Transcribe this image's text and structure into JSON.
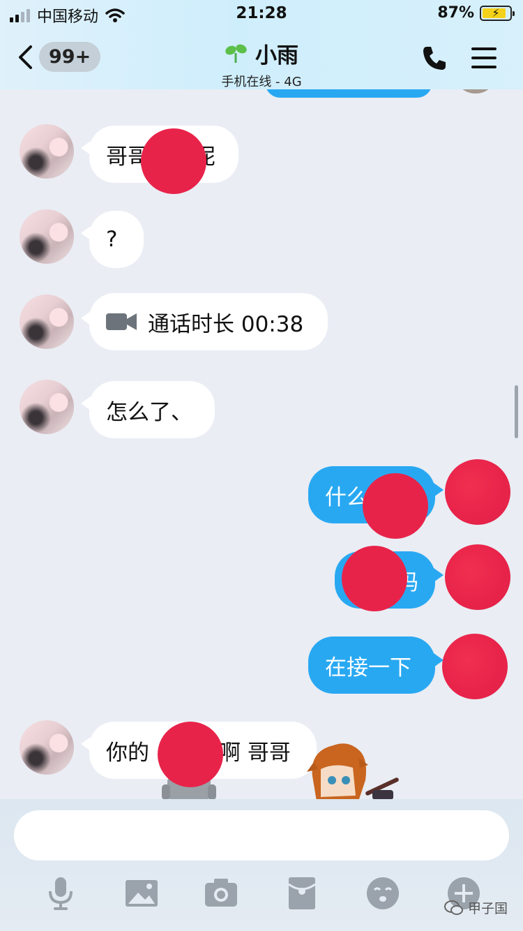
{
  "status_bar": {
    "carrier": "中国移动",
    "time": "21:28",
    "battery_percent": "87%",
    "battery_level": 0.87
  },
  "header": {
    "unread_badge": "99+",
    "title": "小雨",
    "subtitle": "手机在线 - 4G"
  },
  "messages": {
    "m1": {
      "sender": "them",
      "text": "哥哥",
      "text_tail": "呢"
    },
    "m2": {
      "sender": "them",
      "text": "?"
    },
    "m3": {
      "sender": "them",
      "text": "通话时长 00:38",
      "icon": "video-call-icon"
    },
    "m4": {
      "sender": "them",
      "text": "怎么了、"
    },
    "m5": {
      "sender": "me",
      "text": "什么"
    },
    "m6": {
      "sender": "me",
      "text": "吗"
    },
    "m7": {
      "sender": "me",
      "text": "在接一下"
    },
    "m8": {
      "sender": "them",
      "text": "你的",
      "text_tail": "啊 哥哥"
    }
  },
  "input": {
    "value": "",
    "placeholder": ""
  },
  "toolbar": {
    "icons": [
      "microphone-icon",
      "image-icon",
      "camera-icon",
      "red-packet-icon",
      "emoji-icon",
      "plus-icon"
    ]
  },
  "watermark": {
    "text": "甲子国"
  },
  "colors": {
    "outgoing_bubble": "#29a8f2",
    "incoming_bubble": "#ffffff",
    "background": "#eaedf4",
    "redaction": "#e8234a"
  }
}
